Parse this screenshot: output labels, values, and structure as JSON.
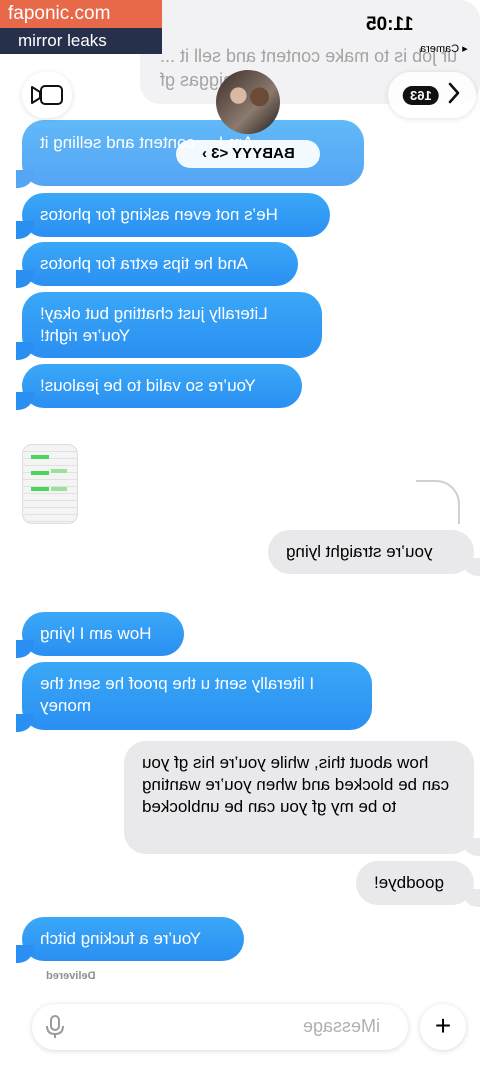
{
  "watermark": {
    "site": "faponic.com",
    "tag": "mirror leaks"
  },
  "status": {
    "time": "11:05",
    "back_label": "◂ Camera"
  },
  "header": {
    "contact_name": "BABYYY <3 ›",
    "badge": "163"
  },
  "faded_message": "ur job is to make content and sell it ... a niggas gf",
  "messages": [
    {
      "id": "m1",
      "side": "blue",
      "text": "Am I ... content and selling it"
    },
    {
      "id": "m2",
      "side": "blue",
      "text": "He’s not even asking for photos"
    },
    {
      "id": "m3",
      "side": "blue",
      "text": "And he tips extra for photos"
    },
    {
      "id": "m4",
      "side": "blue",
      "text": "Literally just chatting but okay! You’re right!"
    },
    {
      "id": "m5",
      "side": "blue",
      "text": "You’re so valid to be jealous!"
    },
    {
      "id": "m6",
      "side": "gray",
      "text": "you’re straight lying"
    },
    {
      "id": "m7",
      "side": "blue",
      "text": "How am I lying"
    },
    {
      "id": "m8",
      "side": "blue",
      "text": "I literally sent u the proof he sent the money"
    },
    {
      "id": "m9",
      "side": "gray",
      "text": "how about this, while you’re his gf you can be blocked and when you’re wanting to be my gf you can be unblocked"
    },
    {
      "id": "m10",
      "side": "gray",
      "text": "goodbye!"
    },
    {
      "id": "m11",
      "side": "blue",
      "text": "You’re a fucking bitch"
    }
  ],
  "delivered_label": "Delivered",
  "composer": {
    "placeholder": "iMessage",
    "plus": "+"
  }
}
